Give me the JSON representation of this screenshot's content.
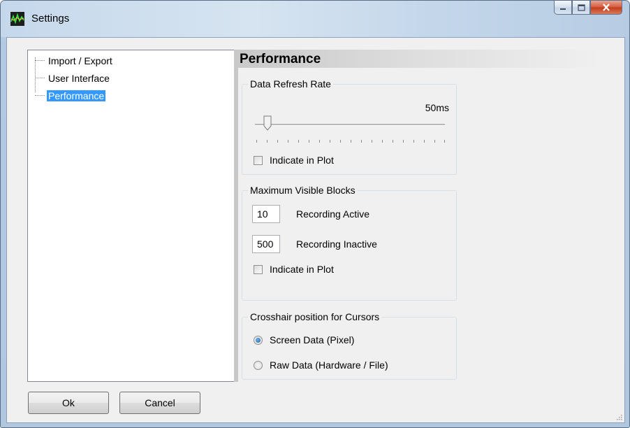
{
  "window": {
    "title": "Settings"
  },
  "tree": {
    "items": [
      {
        "label": "Import / Export"
      },
      {
        "label": "User Interface"
      },
      {
        "label": "Performance",
        "selected": true
      }
    ]
  },
  "performance": {
    "header": "Performance",
    "refresh": {
      "title": "Data Refresh Rate",
      "value_label": "50ms",
      "indicate_label": "Indicate in Plot",
      "indicate_checked": false
    },
    "blocks": {
      "title": "Maximum Visible Blocks",
      "active_value": "10",
      "active_label": "Recording Active",
      "inactive_value": "500",
      "inactive_label": "Recording Inactive",
      "indicate_label": "Indicate in Plot",
      "indicate_checked": false
    },
    "crosshair": {
      "title": "Crosshair position for Cursors",
      "options": [
        {
          "label": "Screen Data (Pixel)",
          "selected": true
        },
        {
          "label": "Raw Data (Hardware / File)",
          "selected": false
        }
      ]
    }
  },
  "buttons": {
    "ok": "Ok",
    "cancel": "Cancel"
  },
  "icons": {
    "app": "waveform-icon",
    "minimize": "minimize-icon",
    "maximize": "maximize-icon",
    "close": "close-icon",
    "grip": "resize-grip-icon"
  }
}
